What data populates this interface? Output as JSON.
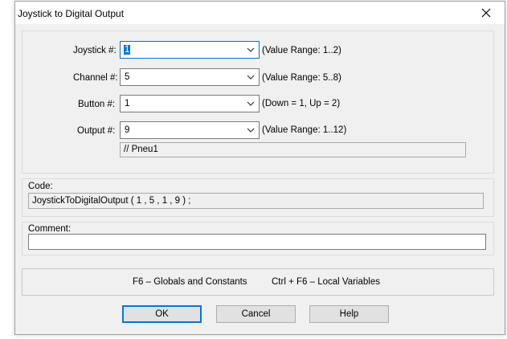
{
  "window": {
    "title": "Joystick to Digital Output"
  },
  "fields": [
    {
      "label": "Joystick #:",
      "value": "1",
      "hint": "(Value Range: 1..2)"
    },
    {
      "label": "Channel #:",
      "value": "5",
      "hint": "(Value Range: 5..8)"
    },
    {
      "label": "Button #:",
      "value": "1",
      "hint": "(Down = 1, Up = 2)"
    },
    {
      "label": "Output #:",
      "value": "9",
      "hint": "(Value Range: 1..12)"
    }
  ],
  "output_comment": "// Pneu1",
  "code": {
    "label": "Code:",
    "value": "JoystickToDigitalOutput ( 1 , 5 , 1 , 9 ) ;"
  },
  "comment": {
    "label": "Comment:",
    "value": ""
  },
  "shortcuts": {
    "globals": "F6 – Globals and Constants",
    "locals": "Ctrl + F6 – Local Variables"
  },
  "buttons": {
    "ok": "OK",
    "cancel": "Cancel",
    "help": "Help"
  },
  "icons": {
    "close": "close-icon",
    "dropdown": "chevron-down-icon"
  },
  "colors": {
    "accent": "#0078d7",
    "dialog_bg": "#f0f0f0"
  }
}
